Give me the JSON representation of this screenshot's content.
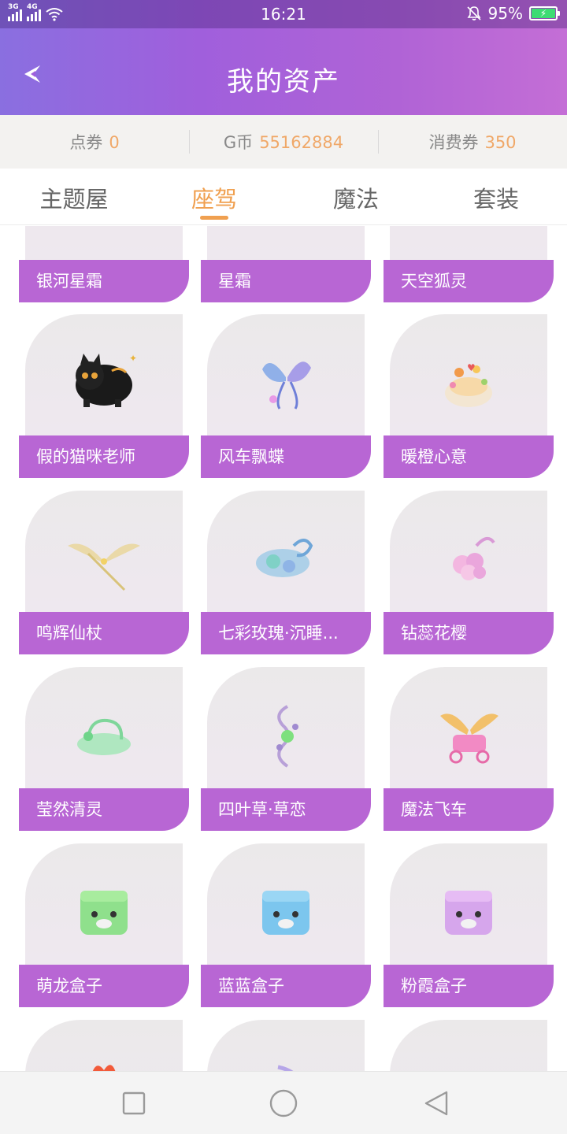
{
  "status_bar": {
    "network_1": "3G",
    "network_2": "4G",
    "time": "16:21",
    "battery": "95%",
    "icons": [
      "signal-icon",
      "wifi-icon",
      "bell-muted-icon",
      "battery-charging-icon"
    ]
  },
  "header": {
    "title": "我的资产",
    "back_icon": "back-arrow-icon",
    "colors": {
      "gradient_start": "#8a6fe0",
      "gradient_end": "#c46ed6"
    }
  },
  "balance": [
    {
      "label": "点券",
      "value": "0"
    },
    {
      "label": "G币",
      "value": "55162884"
    },
    {
      "label": "消费券",
      "value": "350"
    }
  ],
  "tabs": [
    {
      "label": "主题屋",
      "active": false
    },
    {
      "label": "座驾",
      "active": true
    },
    {
      "label": "魔法",
      "active": false
    },
    {
      "label": "套装",
      "active": false
    }
  ],
  "accent_color": "#f0a050",
  "label_color": "#b866d4",
  "items": [
    {
      "name": "银河星霜",
      "icon": "galaxy-frost-mount"
    },
    {
      "name": "星霜",
      "icon": "star-frost-mount"
    },
    {
      "name": "天空狐灵",
      "icon": "sky-fox-mount"
    },
    {
      "name": "假的猫咪老师",
      "icon": "black-cat-mount"
    },
    {
      "name": "风车飘蝶",
      "icon": "butterfly-mount"
    },
    {
      "name": "暖橙心意",
      "icon": "orange-heart-mount"
    },
    {
      "name": "鸣辉仙杖",
      "icon": "golden-wings-mount"
    },
    {
      "name": "七彩玫瑰·沉睡...",
      "icon": "rose-mount"
    },
    {
      "name": "钻蕊花樱",
      "icon": "pink-blossom-mount"
    },
    {
      "name": "莹然清灵",
      "icon": "green-spirit-mount"
    },
    {
      "name": "四叶草·草恋",
      "icon": "clover-mount"
    },
    {
      "name": "魔法飞车",
      "icon": "magic-carriage-mount"
    },
    {
      "name": "萌龙盒子",
      "icon": "green-box-mount"
    },
    {
      "name": "蓝蓝盒子",
      "icon": "blue-box-mount"
    },
    {
      "name": "粉霞盒子",
      "icon": "purple-box-mount"
    },
    {
      "name": "",
      "icon": "fire-mount"
    },
    {
      "name": "",
      "icon": "moon-mount"
    },
    {
      "name": "",
      "icon": "flower-mount"
    }
  ],
  "navbar": [
    "square-recents-icon",
    "circle-home-icon",
    "triangle-back-icon"
  ]
}
